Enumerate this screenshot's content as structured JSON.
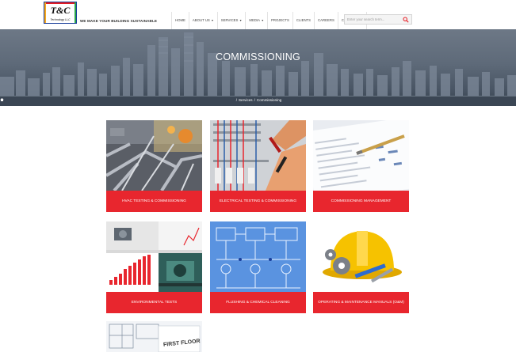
{
  "header": {
    "logo_text": "T&C",
    "logo_sub": "Technology LLC",
    "tagline": "WE MAKE YOUR BUILDING SUSTAINABLE",
    "nav": [
      {
        "label": "HOME",
        "dropdown": false
      },
      {
        "label": "ABOUT US",
        "dropdown": true
      },
      {
        "label": "SERVICES",
        "dropdown": true
      },
      {
        "label": "MEDIA",
        "dropdown": true
      },
      {
        "label": "PROJECTS",
        "dropdown": false
      },
      {
        "label": "CLIENTS",
        "dropdown": false
      },
      {
        "label": "CAREERS",
        "dropdown": false
      },
      {
        "label": "CONTACT US",
        "dropdown": false
      }
    ],
    "search_placeholder": "Enter your search term..."
  },
  "banner": {
    "title": "COMMISSIONING",
    "breadcrumb": [
      "Services",
      "Commissioning"
    ]
  },
  "cards": [
    {
      "label": "HVAC TESTING & COMMISSIONING",
      "icon": "hvac-pipes-image"
    },
    {
      "label": "ELECTRICAL TESTING & COMMISSIONING",
      "icon": "electrical-panel-image"
    },
    {
      "label": "COMMISSIONING MANAGEMENT",
      "icon": "documents-pen-image"
    },
    {
      "label": "ENVIRONMENTAL TESTS",
      "icon": "environmental-test-image"
    },
    {
      "label": "FLUSHING & CHEMICAL CLEANING",
      "icon": "piping-diagram-image"
    },
    {
      "label": "OPERATING & MAINTENANCE MANUALS (O&M)",
      "icon": "hardhat-gears-image"
    },
    {
      "label": "",
      "icon": "floor-plan-image"
    }
  ],
  "colors": {
    "accent": "#e8262e",
    "logo_blue": "#1a3f9b"
  }
}
